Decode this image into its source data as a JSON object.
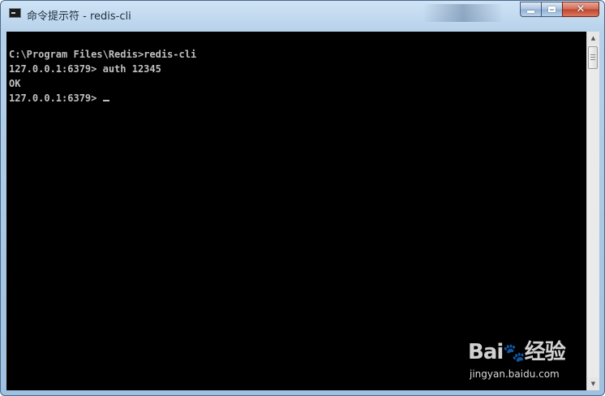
{
  "window": {
    "title": "命令提示符 - redis-cli"
  },
  "console": {
    "lines": [
      "C:\\Program Files\\Redis>redis-cli",
      "127.0.0.1:6379> auth 12345",
      "OK",
      "127.0.0.1:6379> "
    ]
  },
  "watermark": {
    "logo_prefix": "Bai",
    "logo_suffix": "经验",
    "url": "jingyan.baidu.com"
  },
  "colors": {
    "console_bg": "#000000",
    "console_text": "#c0c0c0",
    "close_button": "#c0442c"
  }
}
